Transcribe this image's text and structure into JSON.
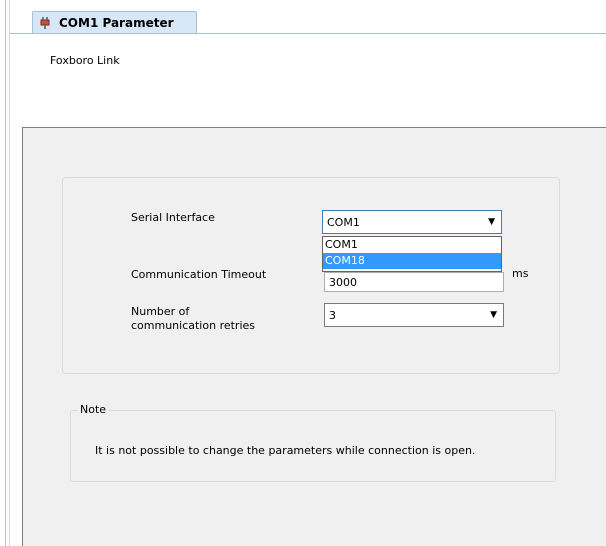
{
  "tab": {
    "title": "COM1 Parameter",
    "icon": "plug-icon"
  },
  "header": {
    "subtitle": "Foxboro Link"
  },
  "settings": {
    "serial_interface": {
      "label": "Serial Interface",
      "value": "COM1",
      "options": [
        "COM1",
        "COM18"
      ],
      "highlighted": "COM18"
    },
    "timeout": {
      "label": "Communication Timeout",
      "value": "3000",
      "unit": "ms"
    },
    "retries": {
      "label_line1": "Number of",
      "label_line2": "communication retries",
      "value": "3"
    }
  },
  "note": {
    "legend": "Note",
    "text": "It is not possible to change the parameters while connection is open."
  },
  "colors": {
    "tab_bg": "#d7e7f7",
    "selection": "#3399ff",
    "panel_bg": "#f0f0f0"
  }
}
